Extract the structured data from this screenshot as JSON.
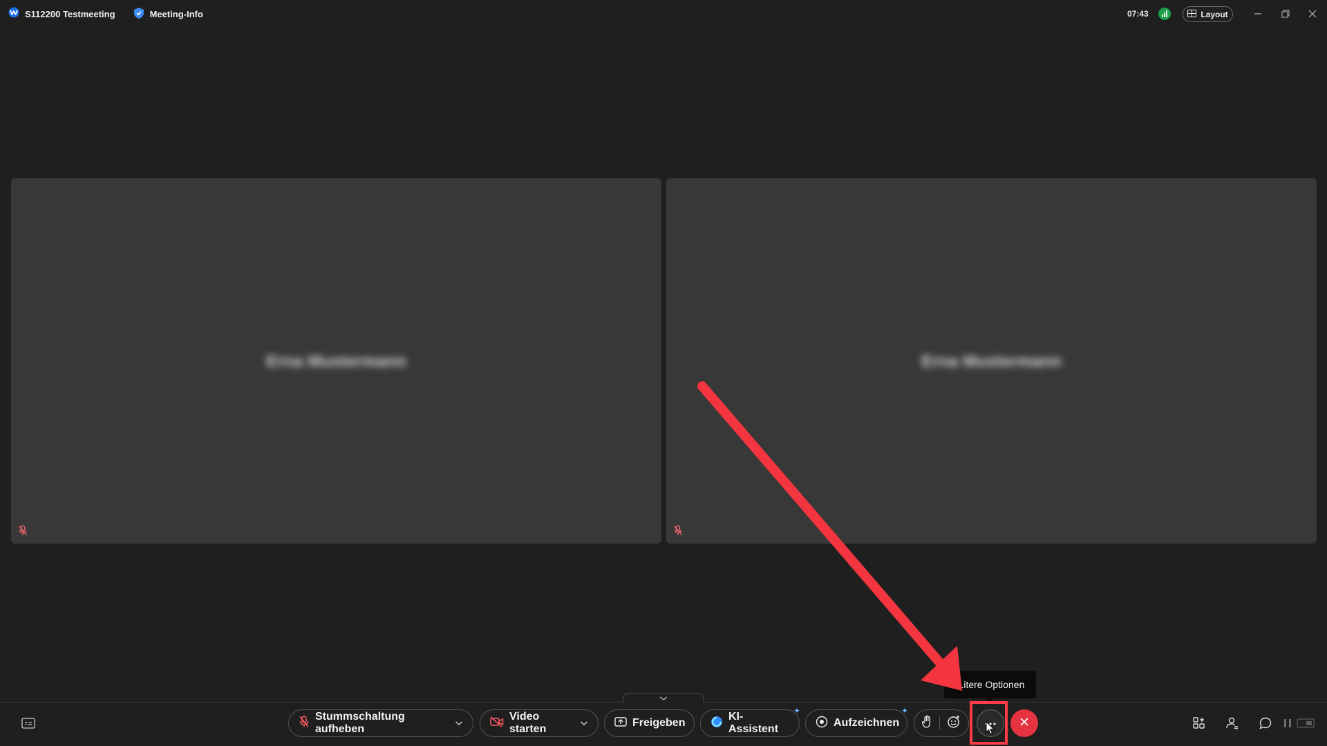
{
  "titlebar": {
    "title": "S112200 Testmeeting",
    "meeting_info_label": "Meeting-Info",
    "clock": "07:43",
    "layout_label": "Layout"
  },
  "tiles": [
    {
      "name": "Erna Mustermann",
      "muted": true
    },
    {
      "name": "Erna Mustermann",
      "muted": true
    }
  ],
  "toolbar": {
    "unmute_label": "Stummschaltung aufheben",
    "video_label": "Video starten",
    "share_label": "Freigeben",
    "ai_label": "KI-Assistent",
    "record_label": "Aufzeichnen",
    "more_tooltip": "...itere Optionen"
  },
  "colors": {
    "background": "#1f1f1f",
    "tile": "#383838",
    "end_call": "#e5333f",
    "annotation": "#ff3b45",
    "accent_blue": "#2f8cff"
  }
}
